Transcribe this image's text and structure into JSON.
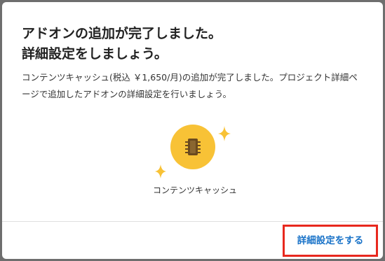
{
  "dialog": {
    "title_line1": "アドオンの追加が完了しました。",
    "title_line2": "詳細設定をしましょう。",
    "description": "コンテンツキャッシュ(税込 ￥1,650/月)の追加が完了しました。プロジェクト詳細ページで追加したアドオンの詳細設定を行いましょう。",
    "addon": {
      "icon": "chip-icon",
      "label": "コンテンツキャッシュ"
    },
    "primary_button_label": "詳細設定をする"
  },
  "colors": {
    "accent": "#1a73c8",
    "addon_circle": "#f8c236",
    "highlight_border": "#e8281e"
  }
}
